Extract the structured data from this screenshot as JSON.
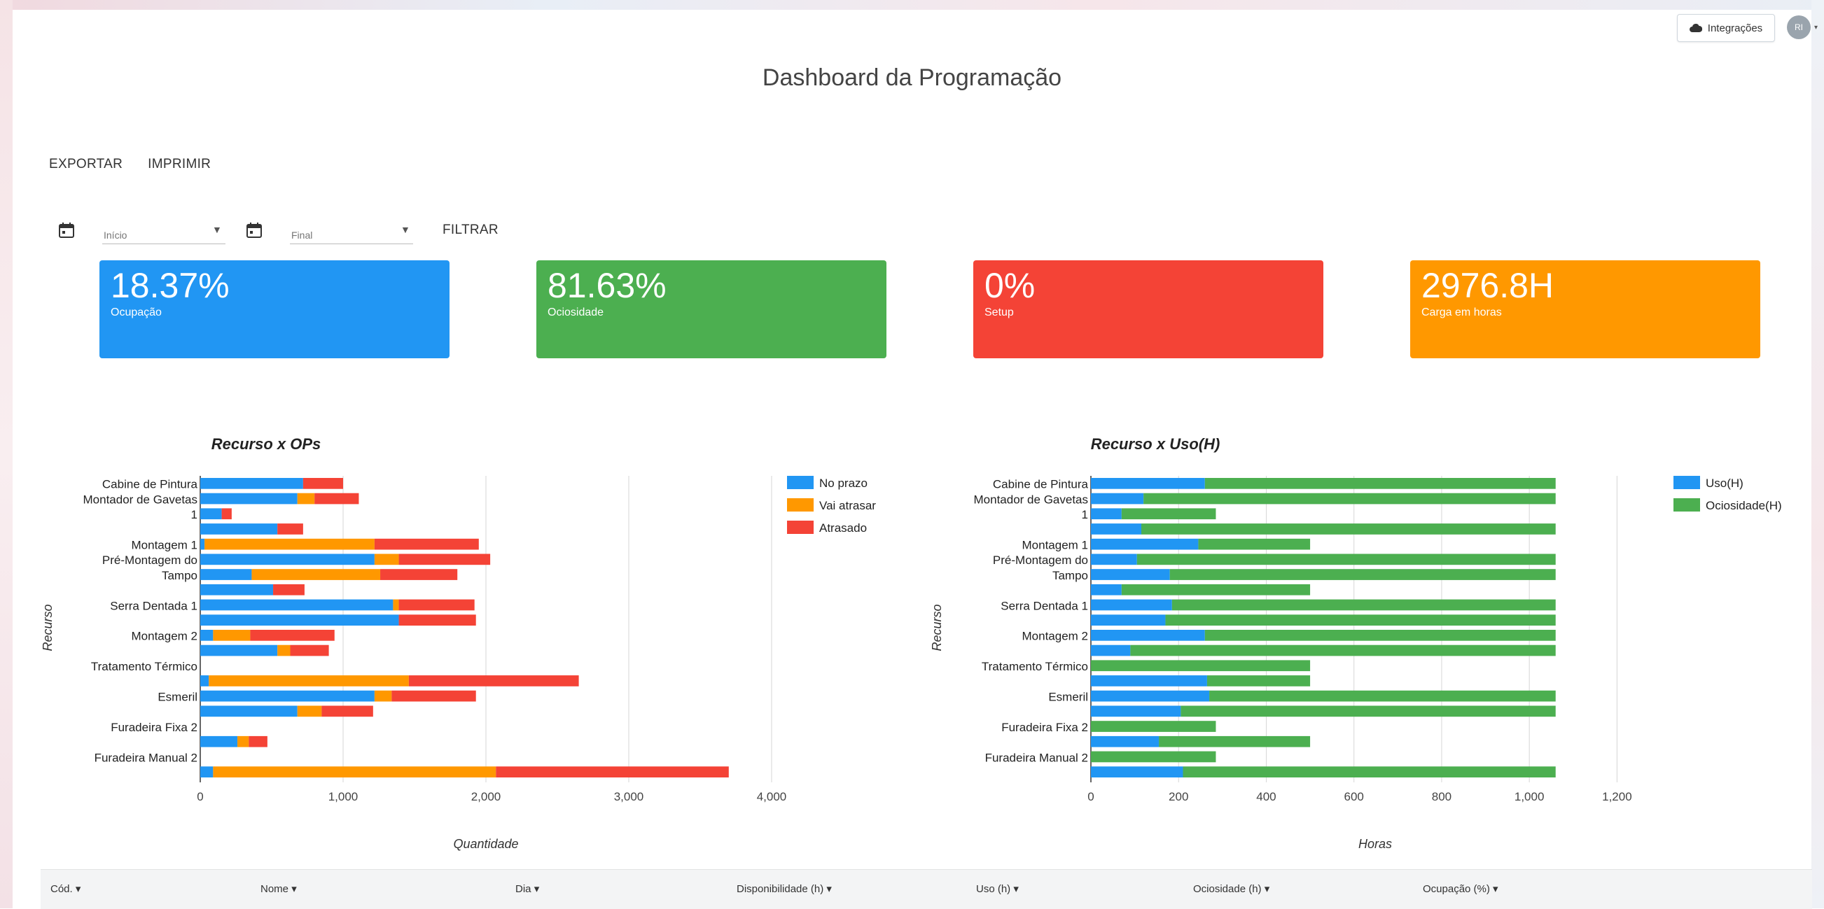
{
  "header": {
    "integrations_label": "Integrações",
    "avatar_initials": "RI",
    "title": "Dashboard da Programação"
  },
  "actions": {
    "export_label": "EXPORTAR",
    "print_label": "IMPRIMIR"
  },
  "filters": {
    "start_placeholder": "Início",
    "end_placeholder": "Final",
    "filter_label": "FILTRAR"
  },
  "kpis": [
    {
      "value": "18.37%",
      "label": "Ocupação",
      "color": "#2196f3"
    },
    {
      "value": "81.63%",
      "label": "Ociosidade",
      "color": "#4caf50"
    },
    {
      "value": "0%",
      "label": "Setup",
      "color": "#f44336"
    },
    {
      "value": "2976.8H",
      "label": "Carga em horas",
      "color": "#ff9800"
    }
  ],
  "chart_data": [
    {
      "type": "bar",
      "orientation": "horizontal",
      "stacked": true,
      "title": "Recurso x OPs",
      "xlabel": "Quantidade",
      "ylabel": "Recurso",
      "xlim": [
        0,
        4000
      ],
      "xticks": [
        "0",
        "1,000",
        "2,000",
        "3,000",
        "4,000"
      ],
      "grid": true,
      "legend_position": "right",
      "categories": [
        "Cabine de Pintura",
        "Montador de Gavetas",
        "1",
        "",
        "Montagem 1",
        "Pré-Montagem do",
        "Tampo",
        "",
        "Serra Dentada 1",
        "",
        "Montagem 2",
        "",
        "Tratamento Térmico",
        "",
        "Esmeril",
        "",
        "Furadeira Fixa 2",
        "",
        "Furadeira Manual 2",
        ""
      ],
      "series": [
        {
          "name": "No prazo",
          "color": "#2196f3",
          "values": [
            720,
            680,
            150,
            540,
            30,
            1220,
            360,
            510,
            1350,
            1390,
            90,
            540,
            0,
            60,
            1220,
            680,
            0,
            260,
            0,
            90
          ]
        },
        {
          "name": "Vai atrasar",
          "color": "#ff9800",
          "values": [
            0,
            120,
            0,
            0,
            1190,
            170,
            900,
            0,
            40,
            0,
            260,
            90,
            0,
            1400,
            120,
            170,
            0,
            80,
            0,
            1980
          ]
        },
        {
          "name": "Atrasado",
          "color": "#f44336",
          "values": [
            280,
            310,
            70,
            180,
            730,
            640,
            540,
            220,
            530,
            540,
            590,
            270,
            0,
            1190,
            590,
            360,
            0,
            130,
            0,
            1630
          ]
        }
      ]
    },
    {
      "type": "bar",
      "orientation": "horizontal",
      "stacked": true,
      "title": "Recurso x Uso(H)",
      "xlabel": "Horas",
      "ylabel": "Recurso",
      "xlim": [
        0,
        1300
      ],
      "xticks": [
        "0",
        "200",
        "400",
        "600",
        "800",
        "1,000",
        "1,200"
      ],
      "grid": true,
      "legend_position": "right",
      "categories": [
        "Cabine de Pintura",
        "Montador de Gavetas",
        "1",
        "",
        "Montagem 1",
        "Pré-Montagem do",
        "Tampo",
        "",
        "Serra Dentada 1",
        "",
        "Montagem 2",
        "",
        "Tratamento Térmico",
        "",
        "Esmeril",
        "",
        "Furadeira Fixa 2",
        "",
        "Furadeira Manual 2",
        ""
      ],
      "series": [
        {
          "name": "Uso(H)",
          "color": "#2196f3",
          "values": [
            260,
            120,
            70,
            115,
            245,
            105,
            180,
            70,
            185,
            170,
            260,
            90,
            0,
            265,
            270,
            205,
            0,
            155,
            0,
            210
          ]
        },
        {
          "name": "Ociosidade(H)",
          "color": "#4caf50",
          "values": [
            800,
            940,
            215,
            945,
            255,
            955,
            880,
            430,
            875,
            890,
            800,
            970,
            500,
            235,
            790,
            855,
            285,
            345,
            285,
            850
          ]
        }
      ]
    }
  ],
  "table": {
    "columns": [
      "Cód.",
      "Nome",
      "Dia",
      "Disponibilidade (h)",
      "Uso (h)",
      "Ociosidade (h)",
      "Ocupação (%)"
    ]
  }
}
